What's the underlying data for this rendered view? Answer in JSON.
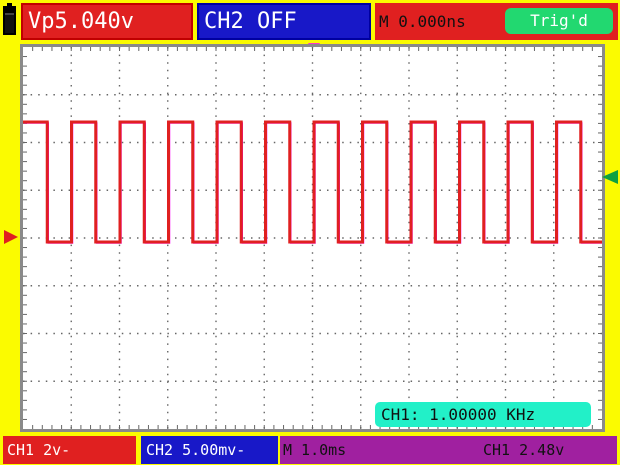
{
  "status": {
    "ch1_measure": "Vp5.040v",
    "ch2_state": "CH2 OFF",
    "timebase_offset": "M  0.000ns",
    "trigger_state": "Trig'd"
  },
  "frequency_readout": "CH1: 1.00000 KHz",
  "bottom": {
    "ch1_scale": "CH1 2v-",
    "ch2_scale": "CH2 5.00mv-",
    "time_scale": "M 1.0ms",
    "trigger_level": "CH1 2.48v"
  },
  "colors": {
    "background": "#fbfb00",
    "ch1": "#e02020",
    "ch2": "#1818c8",
    "trigger_ok": "#22d870",
    "freq_box": "#22f0c8",
    "grid": "#8a8a8a"
  },
  "icons": [
    "battery-icon",
    "trigger-position-marker-icon",
    "ch1-ground-marker-icon",
    "trigger-level-marker-icon"
  ]
}
